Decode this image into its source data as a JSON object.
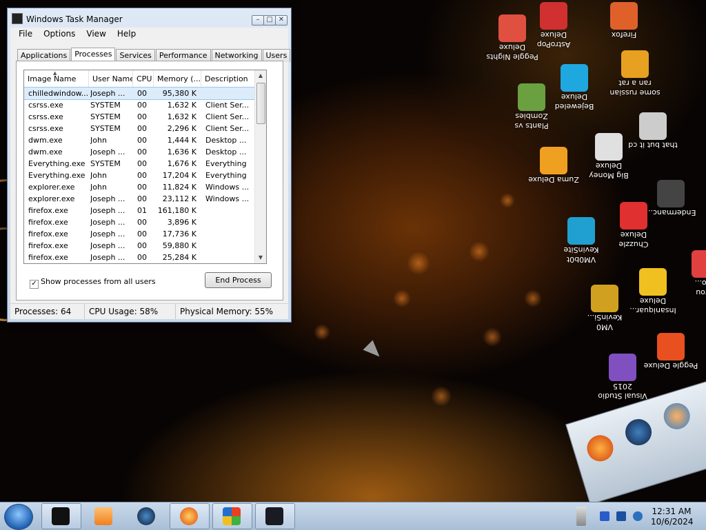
{
  "window": {
    "title": "Windows Task Manager",
    "controls": {
      "minimize": "–",
      "maximize": "□",
      "close": "✕"
    }
  },
  "menu": [
    "File",
    "Options",
    "View",
    "Help"
  ],
  "tabs": [
    "Applications",
    "Processes",
    "Services",
    "Performance",
    "Networking",
    "Users"
  ],
  "active_tab": "Processes",
  "columns": [
    "Image Name",
    "User Name",
    "CPU",
    "Memory (...",
    "Description"
  ],
  "processes": [
    {
      "name": "chilledwindow...",
      "user": "Joseph ...",
      "cpu": "00",
      "memory": "95,380 K",
      "desc": ""
    },
    {
      "name": "csrss.exe",
      "user": "SYSTEM",
      "cpu": "00",
      "memory": "1,632 K",
      "desc": "Client Ser..."
    },
    {
      "name": "csrss.exe",
      "user": "SYSTEM",
      "cpu": "00",
      "memory": "1,632 K",
      "desc": "Client Ser..."
    },
    {
      "name": "csrss.exe",
      "user": "SYSTEM",
      "cpu": "00",
      "memory": "2,296 K",
      "desc": "Client Ser..."
    },
    {
      "name": "dwm.exe",
      "user": "John",
      "cpu": "00",
      "memory": "1,444 K",
      "desc": "Desktop ..."
    },
    {
      "name": "dwm.exe",
      "user": "Joseph ...",
      "cpu": "00",
      "memory": "1,636 K",
      "desc": "Desktop ..."
    },
    {
      "name": "Everything.exe",
      "user": "SYSTEM",
      "cpu": "00",
      "memory": "1,676 K",
      "desc": "Everything"
    },
    {
      "name": "Everything.exe",
      "user": "John",
      "cpu": "00",
      "memory": "17,204 K",
      "desc": "Everything"
    },
    {
      "name": "explorer.exe",
      "user": "John",
      "cpu": "00",
      "memory": "11,824 K",
      "desc": "Windows ..."
    },
    {
      "name": "explorer.exe",
      "user": "Joseph ...",
      "cpu": "00",
      "memory": "23,112 K",
      "desc": "Windows ..."
    },
    {
      "name": "firefox.exe",
      "user": "Joseph ...",
      "cpu": "01",
      "memory": "161,180 K",
      "desc": ""
    },
    {
      "name": "firefox.exe",
      "user": "Joseph ...",
      "cpu": "00",
      "memory": "3,896 K",
      "desc": ""
    },
    {
      "name": "firefox.exe",
      "user": "Joseph ...",
      "cpu": "00",
      "memory": "17,736 K",
      "desc": ""
    },
    {
      "name": "firefox.exe",
      "user": "Joseph ...",
      "cpu": "00",
      "memory": "59,880 K",
      "desc": ""
    },
    {
      "name": "firefox.exe",
      "user": "Joseph ...",
      "cpu": "00",
      "memory": "25,284 K",
      "desc": ""
    }
  ],
  "show_all_label": "Show processes from all users",
  "show_all_checked": "✓",
  "end_process_label": "End Process",
  "status": {
    "processes": "Processes: 64",
    "cpu": "CPU Usage: 58%",
    "memory": "Physical Memory: 55%"
  },
  "desktop_icons": [
    {
      "label": "Peggle Nights\nDeluxe",
      "icon": "peggle-nights-icon",
      "color": "#e05040"
    },
    {
      "label": "AstroPop\nDeluxe",
      "icon": "astropop-icon",
      "color": "#d03030"
    },
    {
      "label": "Firefox",
      "icon": "firefox-icon",
      "color": "#e0602a"
    },
    {
      "label": "Bejeweled\nDeluxe",
      "icon": "bejeweled-icon",
      "color": "#1fa8e0"
    },
    {
      "label": "some russian\nran a rat",
      "icon": "app-icon",
      "color": "#e8a020"
    },
    {
      "label": "Plants vs\nZombies",
      "icon": "plants-vs-zombies-icon",
      "color": "#6aa040"
    },
    {
      "label": "that but it cd",
      "icon": "shortcut-icon",
      "color": "#cccccc"
    },
    {
      "label": "Big Money\nDeluxe",
      "icon": "big-money-icon",
      "color": "#e0e0e0"
    },
    {
      "label": "Zuma Deluxe",
      "icon": "zuma-icon",
      "color": "#f0a020"
    },
    {
      "label": "Endermanc...",
      "icon": "shortcut-icon",
      "color": "#444444"
    },
    {
      "label": "Chuzzle\nDeluxe",
      "icon": "chuzzle-icon",
      "color": "#e03030"
    },
    {
      "label": "VM0b0t\nKevinSite",
      "icon": "vm-icon",
      "color": "#20a0d0"
    },
    {
      "label": "Insaniquar...\nDeluxe",
      "icon": "insaniquarium-icon",
      "color": "#f0c020"
    },
    {
      "label": "VM0\nKevinSi...",
      "icon": "vm-icon",
      "color": "#d0a020"
    },
    {
      "label": "Peggle Deluxe",
      "icon": "peggle-icon",
      "color": "#e85020"
    },
    {
      "label": "Visual Studio\n2015",
      "icon": "visual-studio-icon",
      "color": "#8050c0"
    },
    {
      "label": "f you\nano...",
      "icon": "shortcut-icon",
      "color": "#e04040"
    }
  ],
  "clock": {
    "time": "12:31 AM",
    "date": "10/6/2024"
  }
}
